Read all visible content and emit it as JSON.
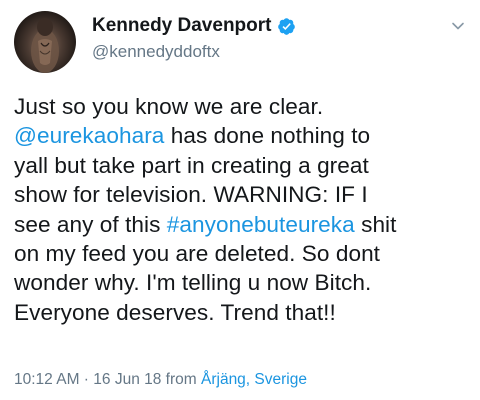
{
  "user": {
    "display_name": "Kennedy Davenport",
    "handle": "@kennedyddoftx",
    "verified": true
  },
  "icons": {
    "verified": "verified-badge-icon",
    "menu": "chevron-down-icon"
  },
  "colors": {
    "link": "#1b95e0",
    "secondary_text": "#657786",
    "primary_text": "#14171a"
  },
  "tweet": {
    "lines": [
      [
        {
          "text": "Just so you know we are clear."
        }
      ],
      [
        {
          "text": "@eurekaohara",
          "link": true
        },
        {
          "text": " has done nothing to"
        }
      ],
      [
        {
          "text": "yall but take part in creating a great"
        }
      ],
      [
        {
          "text": "show for television. WARNING: IF I"
        }
      ],
      [
        {
          "text": "see any of this "
        },
        {
          "text": "#anyonebuteureka",
          "link": true
        },
        {
          "text": " shit"
        }
      ],
      [
        {
          "text": "on my feed you are deleted. So dont"
        }
      ],
      [
        {
          "text": "wonder why. I'm telling u now Bitch."
        }
      ],
      [
        {
          "text": "Everyone deserves. Trend that!!"
        }
      ]
    ]
  },
  "meta": {
    "time": "10:12 AM",
    "separator": " · ",
    "date": "16 Jun 18",
    "from_label": " from ",
    "location": "Årjäng, Sverige"
  }
}
